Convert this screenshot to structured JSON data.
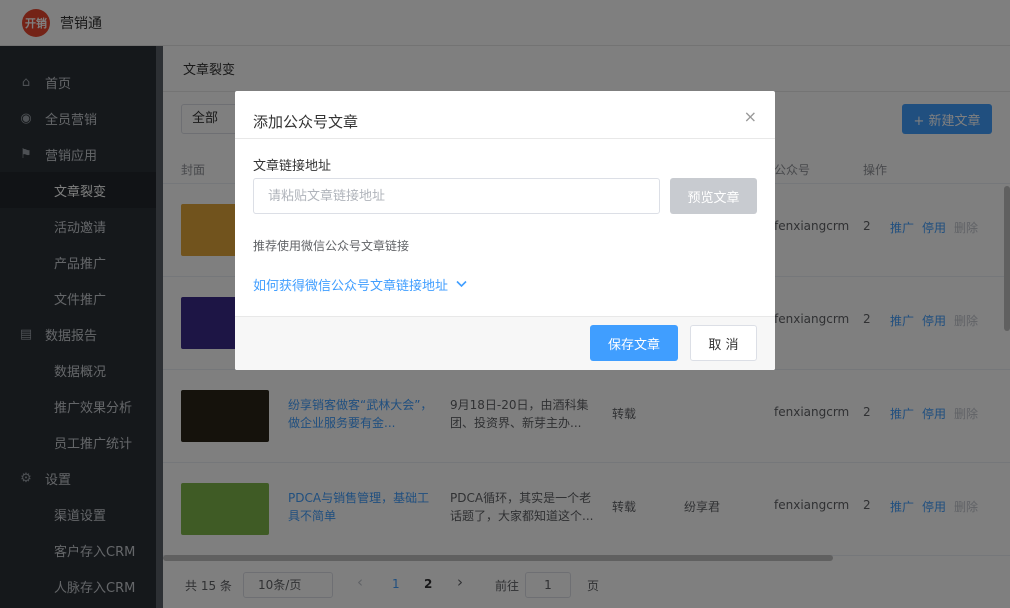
{
  "app": {
    "logo_text": "开销",
    "name": "营销通"
  },
  "sidebar": {
    "items": [
      {
        "label": "首页",
        "type": "group",
        "icon": "home-icon",
        "glyph": "⌂"
      },
      {
        "label": "全员营销",
        "type": "group",
        "icon": "broadcast-icon",
        "glyph": "◉"
      },
      {
        "label": "营销应用",
        "type": "group",
        "icon": "flag-icon",
        "glyph": "⚑"
      },
      {
        "label": "文章裂变",
        "type": "sub",
        "active": true
      },
      {
        "label": "活动邀请",
        "type": "sub"
      },
      {
        "label": "产品推广",
        "type": "sub"
      },
      {
        "label": "文件推广",
        "type": "sub"
      },
      {
        "label": "数据报告",
        "type": "group",
        "icon": "report-icon",
        "glyph": "▤"
      },
      {
        "label": "数据概况",
        "type": "sub"
      },
      {
        "label": "推广效果分析",
        "type": "sub"
      },
      {
        "label": "员工推广统计",
        "type": "sub"
      },
      {
        "label": "设置",
        "type": "group",
        "icon": "gear-icon",
        "glyph": "⚙"
      },
      {
        "label": "渠道设置",
        "type": "sub"
      },
      {
        "label": "客户存入CRM",
        "type": "sub"
      },
      {
        "label": "人脉存入CRM",
        "type": "sub"
      }
    ]
  },
  "main": {
    "breadcrumb": "文章裂变",
    "filter_value": "全部",
    "new_button": "+ 新建文章",
    "columns": {
      "cover": "封面",
      "account": "公众号",
      "actions": "操作"
    },
    "rows": [
      {
        "title": "",
        "desc": "",
        "type": "",
        "author": "",
        "account": "fenxiangcrm",
        "c2": "2",
        "cover_color": "#e2a63a"
      },
      {
        "title": "",
        "desc": "",
        "type": "",
        "author": "",
        "account": "fenxiangcrm",
        "c2": "2",
        "cover_color": "#3a2a8a"
      },
      {
        "title": "纷享销客做客“武林大会”，做企业服务要有金...",
        "desc": "9月18日-20日，由酒科集团、投资界、新芽主办...",
        "type": "转载",
        "author": "",
        "account": "fenxiangcrm",
        "c2": "2",
        "cover_color": "#2a2418"
      },
      {
        "title": "PDCA与销售管理，基础工具不简单",
        "desc": "PDCA循环，其实是一个老话题了，大家都知道这个...",
        "type": "转载",
        "author": "纷享君",
        "account": "fenxiangcrm",
        "c2": "2",
        "cover_color": "#7fb64a"
      }
    ],
    "row_actions": {
      "promote": "推广",
      "disable": "停用",
      "delete": "删除"
    },
    "pagination": {
      "total": "共 15 条",
      "page_size": "10条/页",
      "prev": "‹",
      "pages": [
        "1",
        "2"
      ],
      "next": "›",
      "goto_label": "前往",
      "goto_value": "1",
      "page_suffix": "页"
    }
  },
  "modal": {
    "title": "添加公众号文章",
    "close": "×",
    "field_label": "文章链接地址",
    "input_placeholder": "请粘贴文章链接地址",
    "input_value": "",
    "preview_button": "预览文章",
    "hint": "推荐使用微信公众号文章链接",
    "how_link": "如何获得微信公众号文章链接地址",
    "save_button": "保存文章",
    "cancel_button": "取 消"
  },
  "colors": {
    "accent": "#409eff",
    "sidebar_bg": "#2b3137",
    "logo": "#e8462e",
    "disabled_button": "#c8cbd0"
  }
}
